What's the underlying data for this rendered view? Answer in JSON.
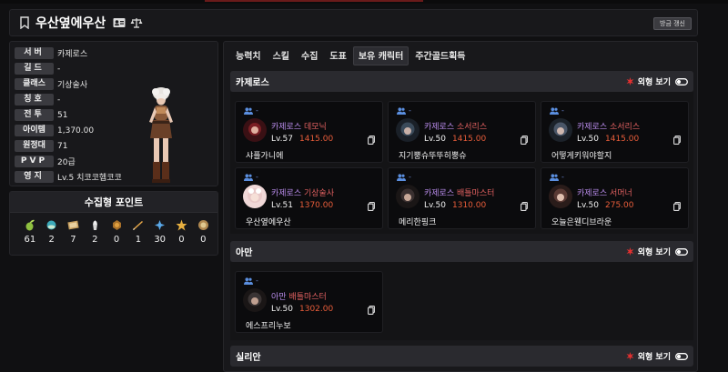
{
  "header": {
    "character_name": "우산옆에우산",
    "refresh_label": "방금 갱신"
  },
  "info": [
    {
      "label": "서버",
      "value": "카제로스"
    },
    {
      "label": "길드",
      "value": "-"
    },
    {
      "label": "클래스",
      "value": "기상술사"
    },
    {
      "label": "칭호",
      "value": "-"
    },
    {
      "label": "전투",
      "value": "51"
    },
    {
      "label": "아이템",
      "value": "1,370.00"
    },
    {
      "label": "원정대",
      "value": "71"
    },
    {
      "label": "PVP",
      "value": "20급"
    },
    {
      "label": "영지",
      "value": "Lv.5 치코코헴코코"
    }
  ],
  "collect": {
    "title": "수집형 포인트",
    "items": [
      {
        "icon": "mokoko-seed-icon",
        "count": "61"
      },
      {
        "icon": "island-heart-icon",
        "count": "2"
      },
      {
        "icon": "masterpiece-icon",
        "count": "7"
      },
      {
        "icon": "giant-heart-icon",
        "count": "2"
      },
      {
        "icon": "ignea-token-icon",
        "count": "0"
      },
      {
        "icon": "adventure-tome-icon",
        "count": "1"
      },
      {
        "icon": "world-tree-leaf-icon",
        "count": "30"
      },
      {
        "icon": "orpheus-star-icon",
        "count": "0"
      },
      {
        "icon": "sea-bounty-icon",
        "count": "0"
      }
    ]
  },
  "tabs": [
    {
      "label": "능력치",
      "active": false
    },
    {
      "label": "스킬",
      "active": false
    },
    {
      "label": "수집",
      "active": false
    },
    {
      "label": "도표",
      "active": false
    },
    {
      "label": "보유 캐릭터",
      "active": true
    },
    {
      "label": "주간골드획득",
      "active": false
    }
  ],
  "view_toggle_label": "외형 보기",
  "colors": {
    "server_text": "#b88bea",
    "class_text": "#e06060",
    "item_level": "#e85d3a",
    "burst": "#e03030"
  },
  "sections": [
    {
      "server": "카제로스",
      "characters": [
        {
          "server": "카제로스",
          "class": "데모닉",
          "level": "Lv.57",
          "item_level": "1415.00",
          "name": "샤플가니에",
          "group": "-",
          "avatar_hue": "#7a1e24"
        },
        {
          "server": "카제로스",
          "class": "소서리스",
          "level": "Lv.50",
          "item_level": "1415.00",
          "name": "지기뿡슈뚜뚜히뿡슈",
          "group": "-",
          "avatar_hue": "#3a4a5a"
        },
        {
          "server": "카제로스",
          "class": "소서리스",
          "level": "Lv.50",
          "item_level": "1415.00",
          "name": "어떻게키워야할지",
          "group": "-",
          "avatar_hue": "#4a5668"
        },
        {
          "server": "카제로스",
          "class": "기상술사",
          "level": "Lv.51",
          "item_level": "1370.00",
          "name": "우산옆에우산",
          "group": "-",
          "avatar_hue": "#d9b8b8"
        },
        {
          "server": "카제로스",
          "class": "배틀마스터",
          "level": "Lv.50",
          "item_level": "1310.00",
          "name": "메리한핑크",
          "group": "-",
          "avatar_hue": "#3a3030"
        },
        {
          "server": "카제로스",
          "class": "서머너",
          "level": "Lv.50",
          "item_level": "275.00",
          "name": "오늘은웬디브라운",
          "group": "-",
          "avatar_hue": "#5a3a34"
        }
      ]
    },
    {
      "server": "아만",
      "characters": [
        {
          "server": "아만",
          "class": "배틀마스터",
          "level": "Lv.50",
          "item_level": "1302.00",
          "name": "에스프리누보",
          "group": "-",
          "avatar_hue": "#3a3434"
        }
      ]
    },
    {
      "server": "실리안",
      "characters": []
    }
  ]
}
